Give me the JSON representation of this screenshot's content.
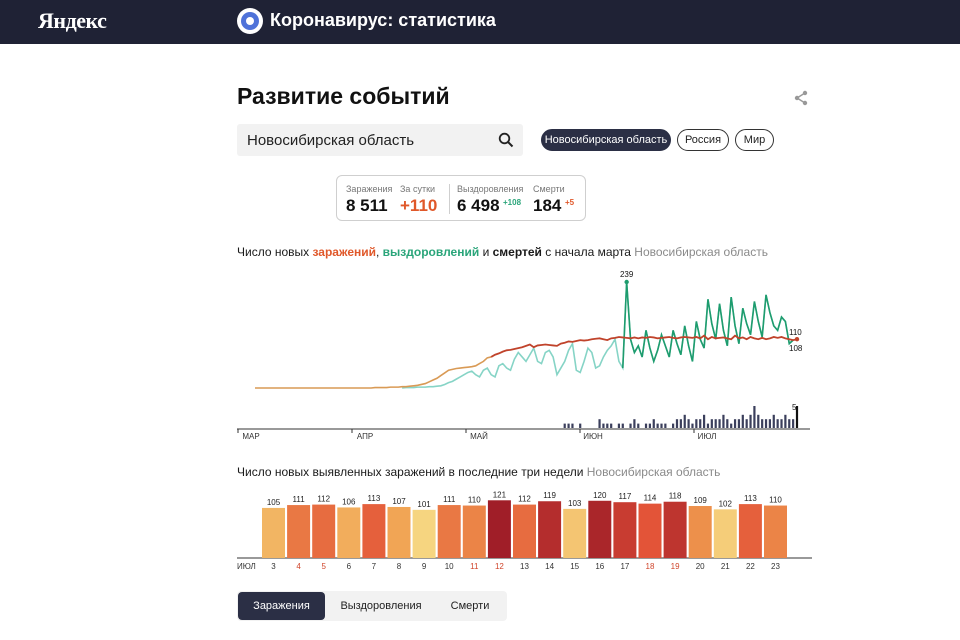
{
  "header": {
    "logo": "Яндекс",
    "service_title": "Коронавирус: статистика"
  },
  "page_title": "Развитие событий",
  "search": {
    "value": "Новосибирская область"
  },
  "region_pills": [
    {
      "label": "Новосибирская область",
      "active": true
    },
    {
      "label": "Россия",
      "active": false
    },
    {
      "label": "Мир",
      "active": false
    }
  ],
  "stats": {
    "infections_label": "Заражения",
    "infections": "8 511",
    "per_day_label": "За сутки",
    "per_day": "+110",
    "recovered_label": "Выздоровления",
    "recovered": "6 498",
    "recovered_delta": "+108",
    "deaths_label": "Смерти",
    "deaths": "184",
    "deaths_delta": "+5"
  },
  "chart1_caption": {
    "p1": "Число новых ",
    "p2": "заражений",
    "p3": ", ",
    "p4": "выздоровлений",
    "p5": " и ",
    "p6": "смертей",
    "p7": " с начала марта",
    "region": "Новосибирская область"
  },
  "chart2_caption": {
    "text": "Число новых выявленных заражений в последние три недели",
    "region": "Новосибирская область"
  },
  "colors": {
    "infections": "#c0432b",
    "infections_early": "#d99a55",
    "recovered": "#1e9c6e",
    "recovered_light": "#86d4c6",
    "deaths": "#3b3f5c",
    "pill_active": "#2b2f45"
  },
  "chart_data": [
    {
      "type": "line",
      "x_labels": [
        "МАР",
        "АПР",
        "МАЙ",
        "ИЮН",
        "ИЮЛ"
      ],
      "series": [
        {
          "name": "заражений",
          "values": [
            0,
            0,
            0,
            0,
            0,
            0,
            0,
            0,
            0,
            0,
            0,
            0,
            0,
            0,
            0,
            0,
            0,
            0,
            0,
            0,
            0,
            0,
            0,
            0,
            0,
            0,
            0,
            0,
            0,
            0,
            0,
            1,
            1,
            1,
            1,
            2,
            2,
            2,
            3,
            3,
            4,
            5,
            6,
            8,
            10,
            14,
            18,
            22,
            28,
            34,
            40,
            42,
            44,
            45,
            46,
            47,
            48,
            50,
            55,
            60,
            68,
            70,
            75,
            78,
            82,
            85,
            86,
            88,
            90,
            92,
            95,
            98,
            92,
            96,
            97,
            98,
            97,
            96,
            95,
            100,
            102,
            105,
            104,
            106,
            108,
            107,
            108,
            110,
            111,
            112,
            110,
            108,
            112,
            113,
            115,
            114,
            113,
            112,
            114,
            112,
            114,
            113,
            115,
            114,
            112,
            113,
            114,
            115,
            113,
            112,
            114,
            115,
            114,
            113,
            115,
            112,
            118,
            110,
            115,
            112,
            113,
            114,
            112,
            110,
            118,
            112,
            114,
            110,
            115,
            112,
            110,
            113,
            110,
            112,
            115,
            113,
            115,
            112,
            110,
            108,
            110
          ]
        },
        {
          "name": "выздоровлений",
          "values": [
            0,
            0,
            0,
            0,
            0,
            0,
            0,
            0,
            0,
            0,
            0,
            0,
            0,
            0,
            0,
            0,
            0,
            0,
            0,
            0,
            0,
            0,
            0,
            0,
            0,
            0,
            0,
            0,
            0,
            0,
            0,
            0,
            0,
            0,
            0,
            0,
            0,
            0,
            0,
            1,
            1,
            1,
            2,
            2,
            2,
            3,
            3,
            4,
            5,
            8,
            12,
            15,
            20,
            25,
            30,
            35,
            38,
            30,
            25,
            40,
            45,
            30,
            25,
            50,
            55,
            45,
            40,
            65,
            80,
            70,
            60,
            75,
            90,
            60,
            55,
            80,
            85,
            70,
            30,
            45,
            60,
            85,
            100,
            40,
            35,
            60,
            90,
            80,
            45,
            50,
            70,
            85,
            95,
            110,
            60,
            45,
            239,
            110,
            80,
            95,
            70,
            130,
            90,
            60,
            85,
            120,
            95,
            70,
            130,
            100,
            75,
            140,
            95,
            60,
            150,
            110,
            90,
            200,
            145,
            110,
            190,
            130,
            95,
            205,
            140,
            100,
            180,
            145,
            120,
            195,
            150,
            115,
            210,
            170,
            140,
            130,
            160,
            150,
            100,
            108
          ]
        },
        {
          "name": "смертей",
          "values": [
            0,
            0,
            0,
            0,
            0,
            0,
            0,
            0,
            0,
            0,
            0,
            0,
            0,
            0,
            0,
            0,
            0,
            0,
            0,
            0,
            0,
            0,
            0,
            0,
            0,
            0,
            0,
            0,
            0,
            0,
            0,
            0,
            0,
            0,
            0,
            0,
            0,
            0,
            0,
            0,
            0,
            0,
            0,
            0,
            0,
            0,
            0,
            0,
            0,
            0,
            0,
            0,
            0,
            0,
            0,
            0,
            0,
            0,
            0,
            0,
            0,
            0,
            0,
            0,
            0,
            0,
            0,
            0,
            0,
            0,
            0,
            0,
            0,
            0,
            0,
            0,
            0,
            0,
            0,
            0,
            1,
            1,
            1,
            0,
            1,
            0,
            0,
            0,
            0,
            2,
            1,
            1,
            1,
            0,
            1,
            1,
            0,
            1,
            2,
            1,
            0,
            1,
            1,
            2,
            1,
            1,
            1,
            0,
            1,
            2,
            2,
            3,
            2,
            1,
            2,
            2,
            3,
            1,
            2,
            2,
            2,
            3,
            2,
            1,
            2,
            2,
            3,
            2,
            3,
            5,
            3,
            2,
            2,
            2,
            3,
            2,
            2,
            3,
            2,
            2,
            5
          ]
        }
      ],
      "annotations": [
        {
          "label": "239"
        },
        {
          "label": "110"
        },
        {
          "label": "108"
        },
        {
          "label": "5"
        }
      ]
    },
    {
      "type": "bar",
      "categories": [
        "3",
        "4",
        "5",
        "6",
        "7",
        "8",
        "9",
        "10",
        "11",
        "12",
        "13",
        "14",
        "15",
        "16",
        "17",
        "18",
        "19",
        "20",
        "21",
        "22",
        "23"
      ],
      "month_label": "ИЮЛ",
      "weekend": [
        false,
        true,
        true,
        false,
        false,
        false,
        false,
        false,
        true,
        true,
        false,
        false,
        false,
        false,
        false,
        true,
        true,
        false,
        false,
        false,
        false
      ],
      "values": [
        105,
        111,
        112,
        106,
        113,
        107,
        101,
        111,
        110,
        121,
        112,
        119,
        103,
        120,
        117,
        114,
        118,
        109,
        102,
        113,
        110
      ],
      "ylim": [
        0,
        130
      ]
    }
  ],
  "bottom_tabs": [
    {
      "label": "Заражения",
      "active": true
    },
    {
      "label": "Выздоровления",
      "active": false
    },
    {
      "label": "Смерти",
      "active": false
    }
  ]
}
